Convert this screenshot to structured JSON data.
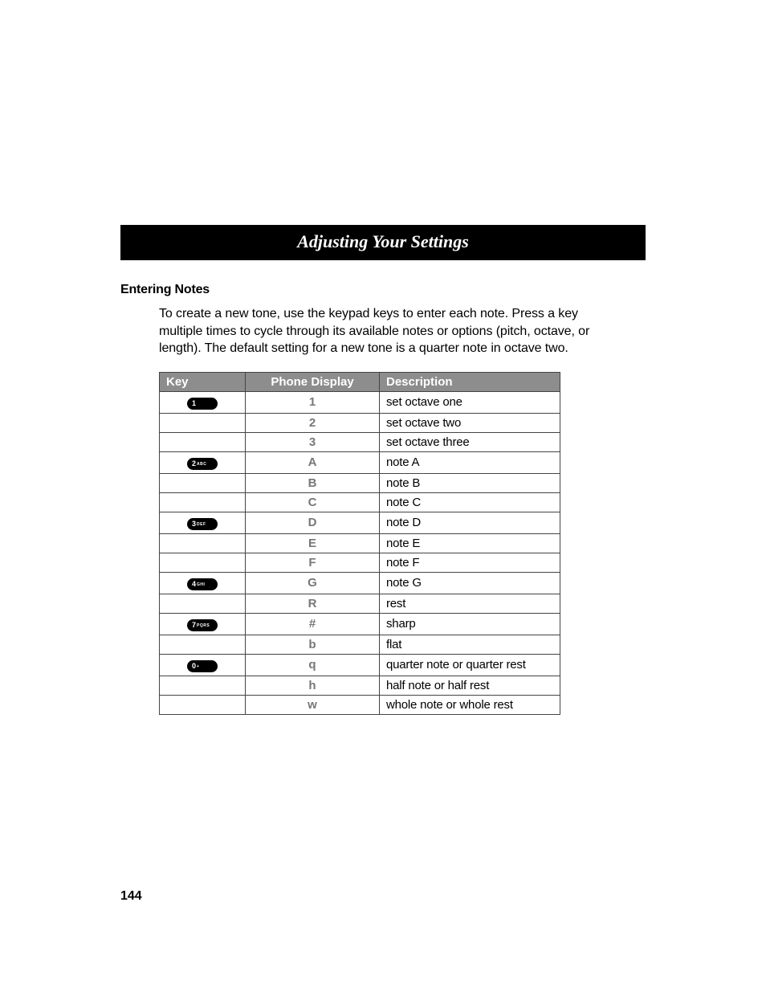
{
  "title": "Adjusting Your Settings",
  "subhead": "Entering Notes",
  "body_paragraph": "To create a new tone, use the keypad keys to enter each note. Press a key multiple times to cycle through its available notes or options (pitch, octave, or length). The default setting for a new tone is a quarter note in octave two.",
  "table": {
    "headers": {
      "key": "Key",
      "display": "Phone Display",
      "desc": "Description"
    },
    "rows": [
      {
        "key_num": "1",
        "key_label": "",
        "display": "1",
        "desc": "set octave one"
      },
      {
        "key_num": "",
        "key_label": "",
        "display": "2",
        "desc": "set octave two"
      },
      {
        "key_num": "",
        "key_label": "",
        "display": "3",
        "desc": "set octave three"
      },
      {
        "key_num": "2",
        "key_label": "ABC",
        "display": "A",
        "desc": "note A"
      },
      {
        "key_num": "",
        "key_label": "",
        "display": "B",
        "desc": "note B"
      },
      {
        "key_num": "",
        "key_label": "",
        "display": "C",
        "desc": "note C"
      },
      {
        "key_num": "3",
        "key_label": "DEF",
        "display": "D",
        "desc": "note D"
      },
      {
        "key_num": "",
        "key_label": "",
        "display": "E",
        "desc": "note E"
      },
      {
        "key_num": "",
        "key_label": "",
        "display": "F",
        "desc": "note F"
      },
      {
        "key_num": "4",
        "key_label": "GHI",
        "display": "G",
        "desc": "note G"
      },
      {
        "key_num": "",
        "key_label": "",
        "display": "R",
        "desc": "rest"
      },
      {
        "key_num": "7",
        "key_label": "PQRS",
        "display": "#",
        "desc": "sharp"
      },
      {
        "key_num": "",
        "key_label": "",
        "display": "b",
        "desc": "flat"
      },
      {
        "key_num": "0",
        "key_label": "+",
        "display": "q",
        "desc": "quarter note or quarter rest"
      },
      {
        "key_num": "",
        "key_label": "",
        "display": "h",
        "desc": "half note or half rest"
      },
      {
        "key_num": "",
        "key_label": "",
        "display": "w",
        "desc": "whole note or whole rest"
      }
    ]
  },
  "page_number": "144"
}
